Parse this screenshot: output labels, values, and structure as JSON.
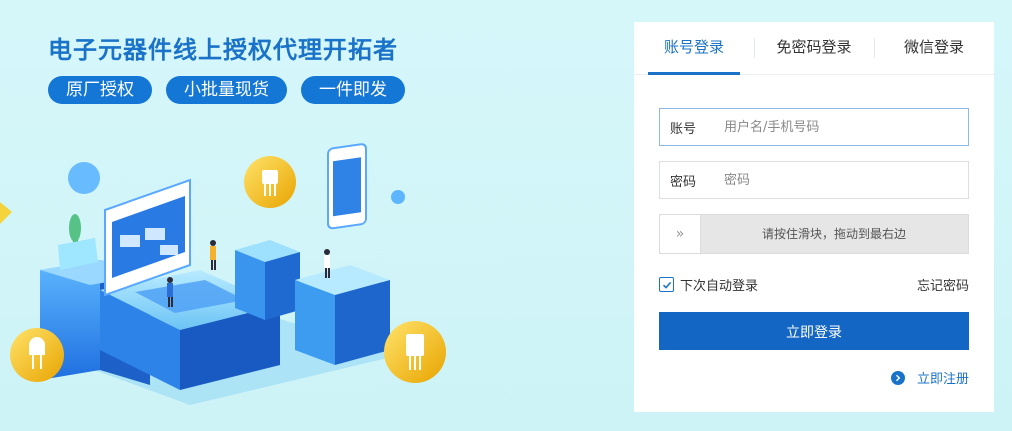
{
  "banner": {
    "headline": "电子元器件线上授权代理开拓者",
    "pills": [
      "原厂授权",
      "小批量现货",
      "一件即发"
    ]
  },
  "login": {
    "tabs": [
      {
        "label": "账号登录",
        "active": true
      },
      {
        "label": "免密码登录",
        "active": false
      },
      {
        "label": "微信登录",
        "active": false
      }
    ],
    "account": {
      "label": "账号",
      "placeholder": "用户名/手机号码",
      "value": ""
    },
    "password": {
      "label": "密码",
      "placeholder": "密码",
      "value": ""
    },
    "slider": {
      "handle_glyph": "»",
      "text": "请按住滑块，拖动到最右边"
    },
    "remember": {
      "label": "下次自动登录",
      "checked": true
    },
    "forgot_label": "忘记密码",
    "submit_label": "立即登录",
    "register_label": "立即注册"
  },
  "colors": {
    "accent": "#1366c3",
    "pill": "#1477d6",
    "background": "#d6f7fa"
  },
  "icons": [
    "slider-arrows-icon",
    "checkmark-icon",
    "chevron-right-circle-icon"
  ]
}
